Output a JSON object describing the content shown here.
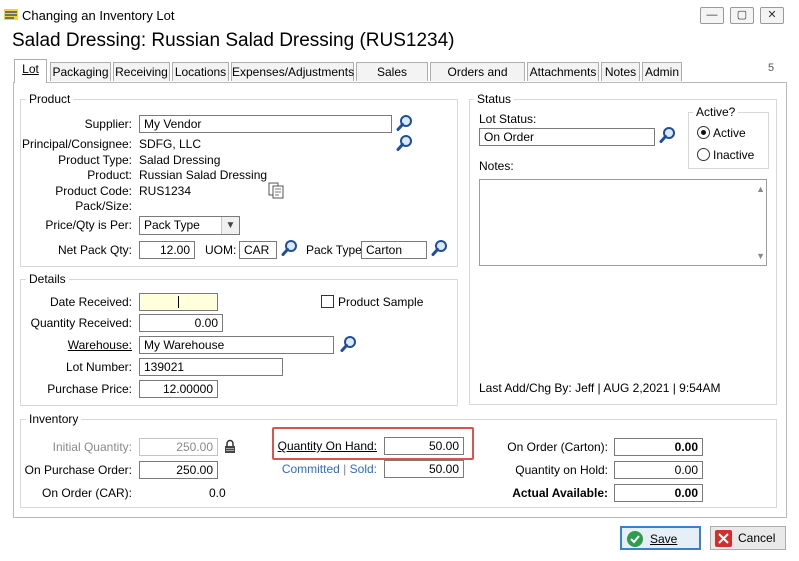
{
  "window": {
    "title": "Changing an Inventory Lot",
    "minimize": "—",
    "maximize": "▢",
    "close": "✕"
  },
  "heading": "Salad Dressing: Russian Salad Dressing (RUS1234)",
  "tabs": [
    {
      "label": "Lot"
    },
    {
      "label": "Packaging"
    },
    {
      "label": "Receiving"
    },
    {
      "label": "Locations"
    },
    {
      "label": "Expenses/Adjustments"
    },
    {
      "label": "Sales Pricing"
    },
    {
      "label": "Orders and BOLs"
    },
    {
      "label": "Attachments"
    },
    {
      "label": "Notes"
    },
    {
      "label": "Admin"
    }
  ],
  "tab_count": "5",
  "product": {
    "title": "Product",
    "supplier_label": "Supplier:",
    "supplier": "My Vendor",
    "principal_label": "Principal/Consignee:",
    "principal": "SDFG, LLC",
    "product_type_label": "Product Type:",
    "product_type": "Salad Dressing",
    "product_label": "Product:",
    "product": "Russian Salad Dressing",
    "product_code_label": "Product Code:",
    "product_code": "RUS1234",
    "pack_size_label": "Pack/Size:",
    "price_qty_label": "Price/Qty is Per:",
    "price_qty": "Pack Type",
    "net_pack_qty_label": "Net Pack Qty:",
    "net_pack_qty": "12.00",
    "uom_label": "UOM:",
    "uom": "CAR",
    "pack_type_label": "Pack Type:",
    "pack_type": "Carton"
  },
  "status": {
    "title": "Status",
    "lot_status_label": "Lot Status:",
    "lot_status": "On Order",
    "notes_label": "Notes:",
    "active_title": "Active?",
    "active_label": "Active",
    "inactive_label": "Inactive",
    "last_chg_label": "Last Add/Chg By:",
    "last_chg_value": "Jeff | AUG  2,2021 |  9:54AM"
  },
  "details": {
    "title": "Details",
    "date_received_label": "Date Received:",
    "date_received": "",
    "product_sample_label": "Product Sample",
    "qty_received_label": "Quantity Received:",
    "qty_received": "0.00",
    "warehouse_label": "Warehouse:",
    "warehouse": "My Warehouse",
    "lot_number_label": "Lot Number:",
    "lot_number": "139021",
    "purchase_price_label": "Purchase Price:",
    "purchase_price": "12.00000"
  },
  "inventory": {
    "title": "Inventory",
    "initial_qty_label": "Initial Quantity:",
    "initial_qty": "250.00",
    "on_po_label": "On Purchase Order:",
    "on_po": "250.00",
    "on_order_car_label": "On Order (CAR):",
    "on_order_car": "0.0",
    "qty_on_hand_label": "Quantity On Hand:",
    "qty_on_hand": "50.00",
    "committed_label": "Committed",
    "sold_label": "Sold:",
    "sep": "|",
    "committed_sold": "50.00",
    "on_order_carton_label": "On Order (Carton):",
    "on_order_carton": "0.00",
    "qty_on_hold_label": "Quantity on Hold:",
    "qty_on_hold": "0.00",
    "actual_available_label": "Actual Available:",
    "actual_available": "0.00"
  },
  "buttons": {
    "save": "Save",
    "cancel": "Cancel"
  },
  "colors": {
    "highlight": "#d9534f",
    "link": "#2b6fc7",
    "save_check": "#2e9c4a",
    "cancel_x": "#d0302c"
  }
}
